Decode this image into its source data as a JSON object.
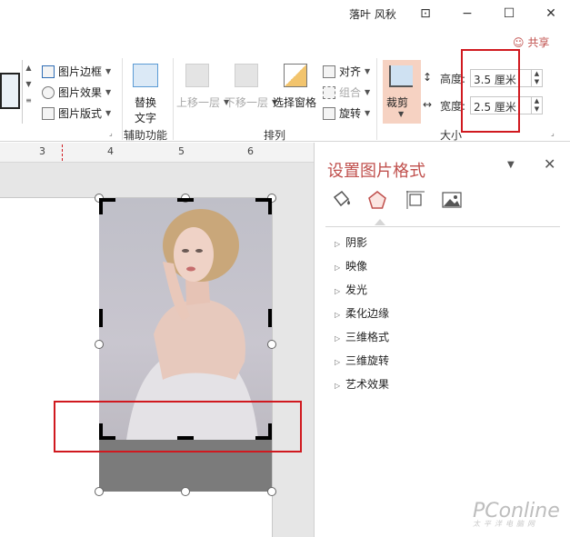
{
  "titlebar": {
    "user": "落叶 风秋",
    "restore_icon": "ribbon-display-icon",
    "minimize": "−",
    "maximize": "☐",
    "close": "✕"
  },
  "share": "共享",
  "ribbon": {
    "picture_border": "图片边框",
    "picture_effects": "图片效果",
    "picture_layout": "图片版式",
    "alt_text_line1": "替换",
    "alt_text_line2": "文字",
    "bring_forward": "上移一层",
    "send_backward": "下移一层",
    "selection_pane": "选择窗格",
    "align": "对齐",
    "group": "组合",
    "rotate": "旋转",
    "crop": "裁剪",
    "height_label": "高度:",
    "width_label": "宽度:",
    "height_value": "3.5 厘米",
    "width_value": "2.5 厘米",
    "groups": {
      "accessibility": "辅助功能",
      "arrange": "排列",
      "size": "大小"
    }
  },
  "ruler": {
    "ticks": [
      "3",
      "4",
      "5",
      "6"
    ]
  },
  "panel": {
    "title": "设置图片格式",
    "sections": [
      "阴影",
      "映像",
      "发光",
      "柔化边缘",
      "三维格式",
      "三维旋转",
      "艺术效果"
    ]
  },
  "watermark": {
    "brand": "PConline",
    "sub": "太平洋电脑网"
  },
  "colors": {
    "accent": "#c0504d",
    "highlight": "#d0191f",
    "crop_fill": "#7b7b7b"
  }
}
